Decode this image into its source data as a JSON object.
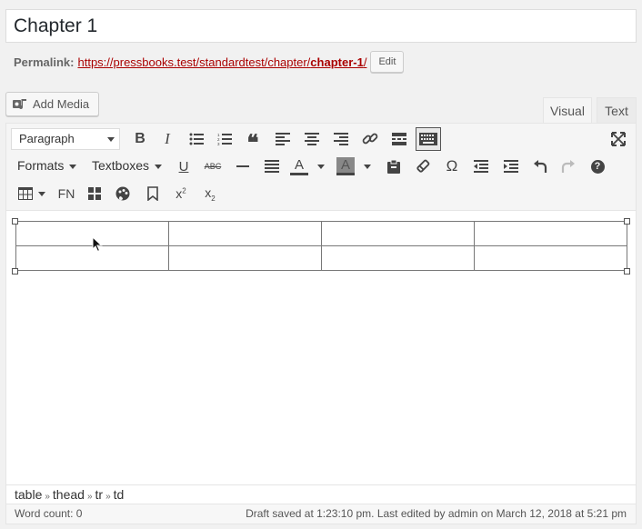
{
  "title": "Chapter 1",
  "permalink": {
    "label": "Permalink:",
    "url_prefix": "https://pressbooks.test/standardtest/chapter/",
    "url_slug": "chapter-1",
    "url_suffix": "/",
    "edit_label": "Edit"
  },
  "add_media_label": "Add Media",
  "tabs": {
    "visual": "Visual",
    "text": "Text"
  },
  "toolbar": {
    "format_select": "Paragraph",
    "formats_label": "Formats",
    "textboxes_label": "Textboxes",
    "fn_label": "FN"
  },
  "path": [
    "table",
    "thead",
    "tr",
    "td"
  ],
  "path_separator": "»",
  "word_count": "Word count: 0",
  "save_status": "Draft saved at 1:23:10 pm. Last edited by admin on March 12, 2018 at 5:21 pm",
  "colors": {
    "link": "#aa0000",
    "toolbar_bg": "#f5f5f5",
    "active_button": "#444444"
  }
}
